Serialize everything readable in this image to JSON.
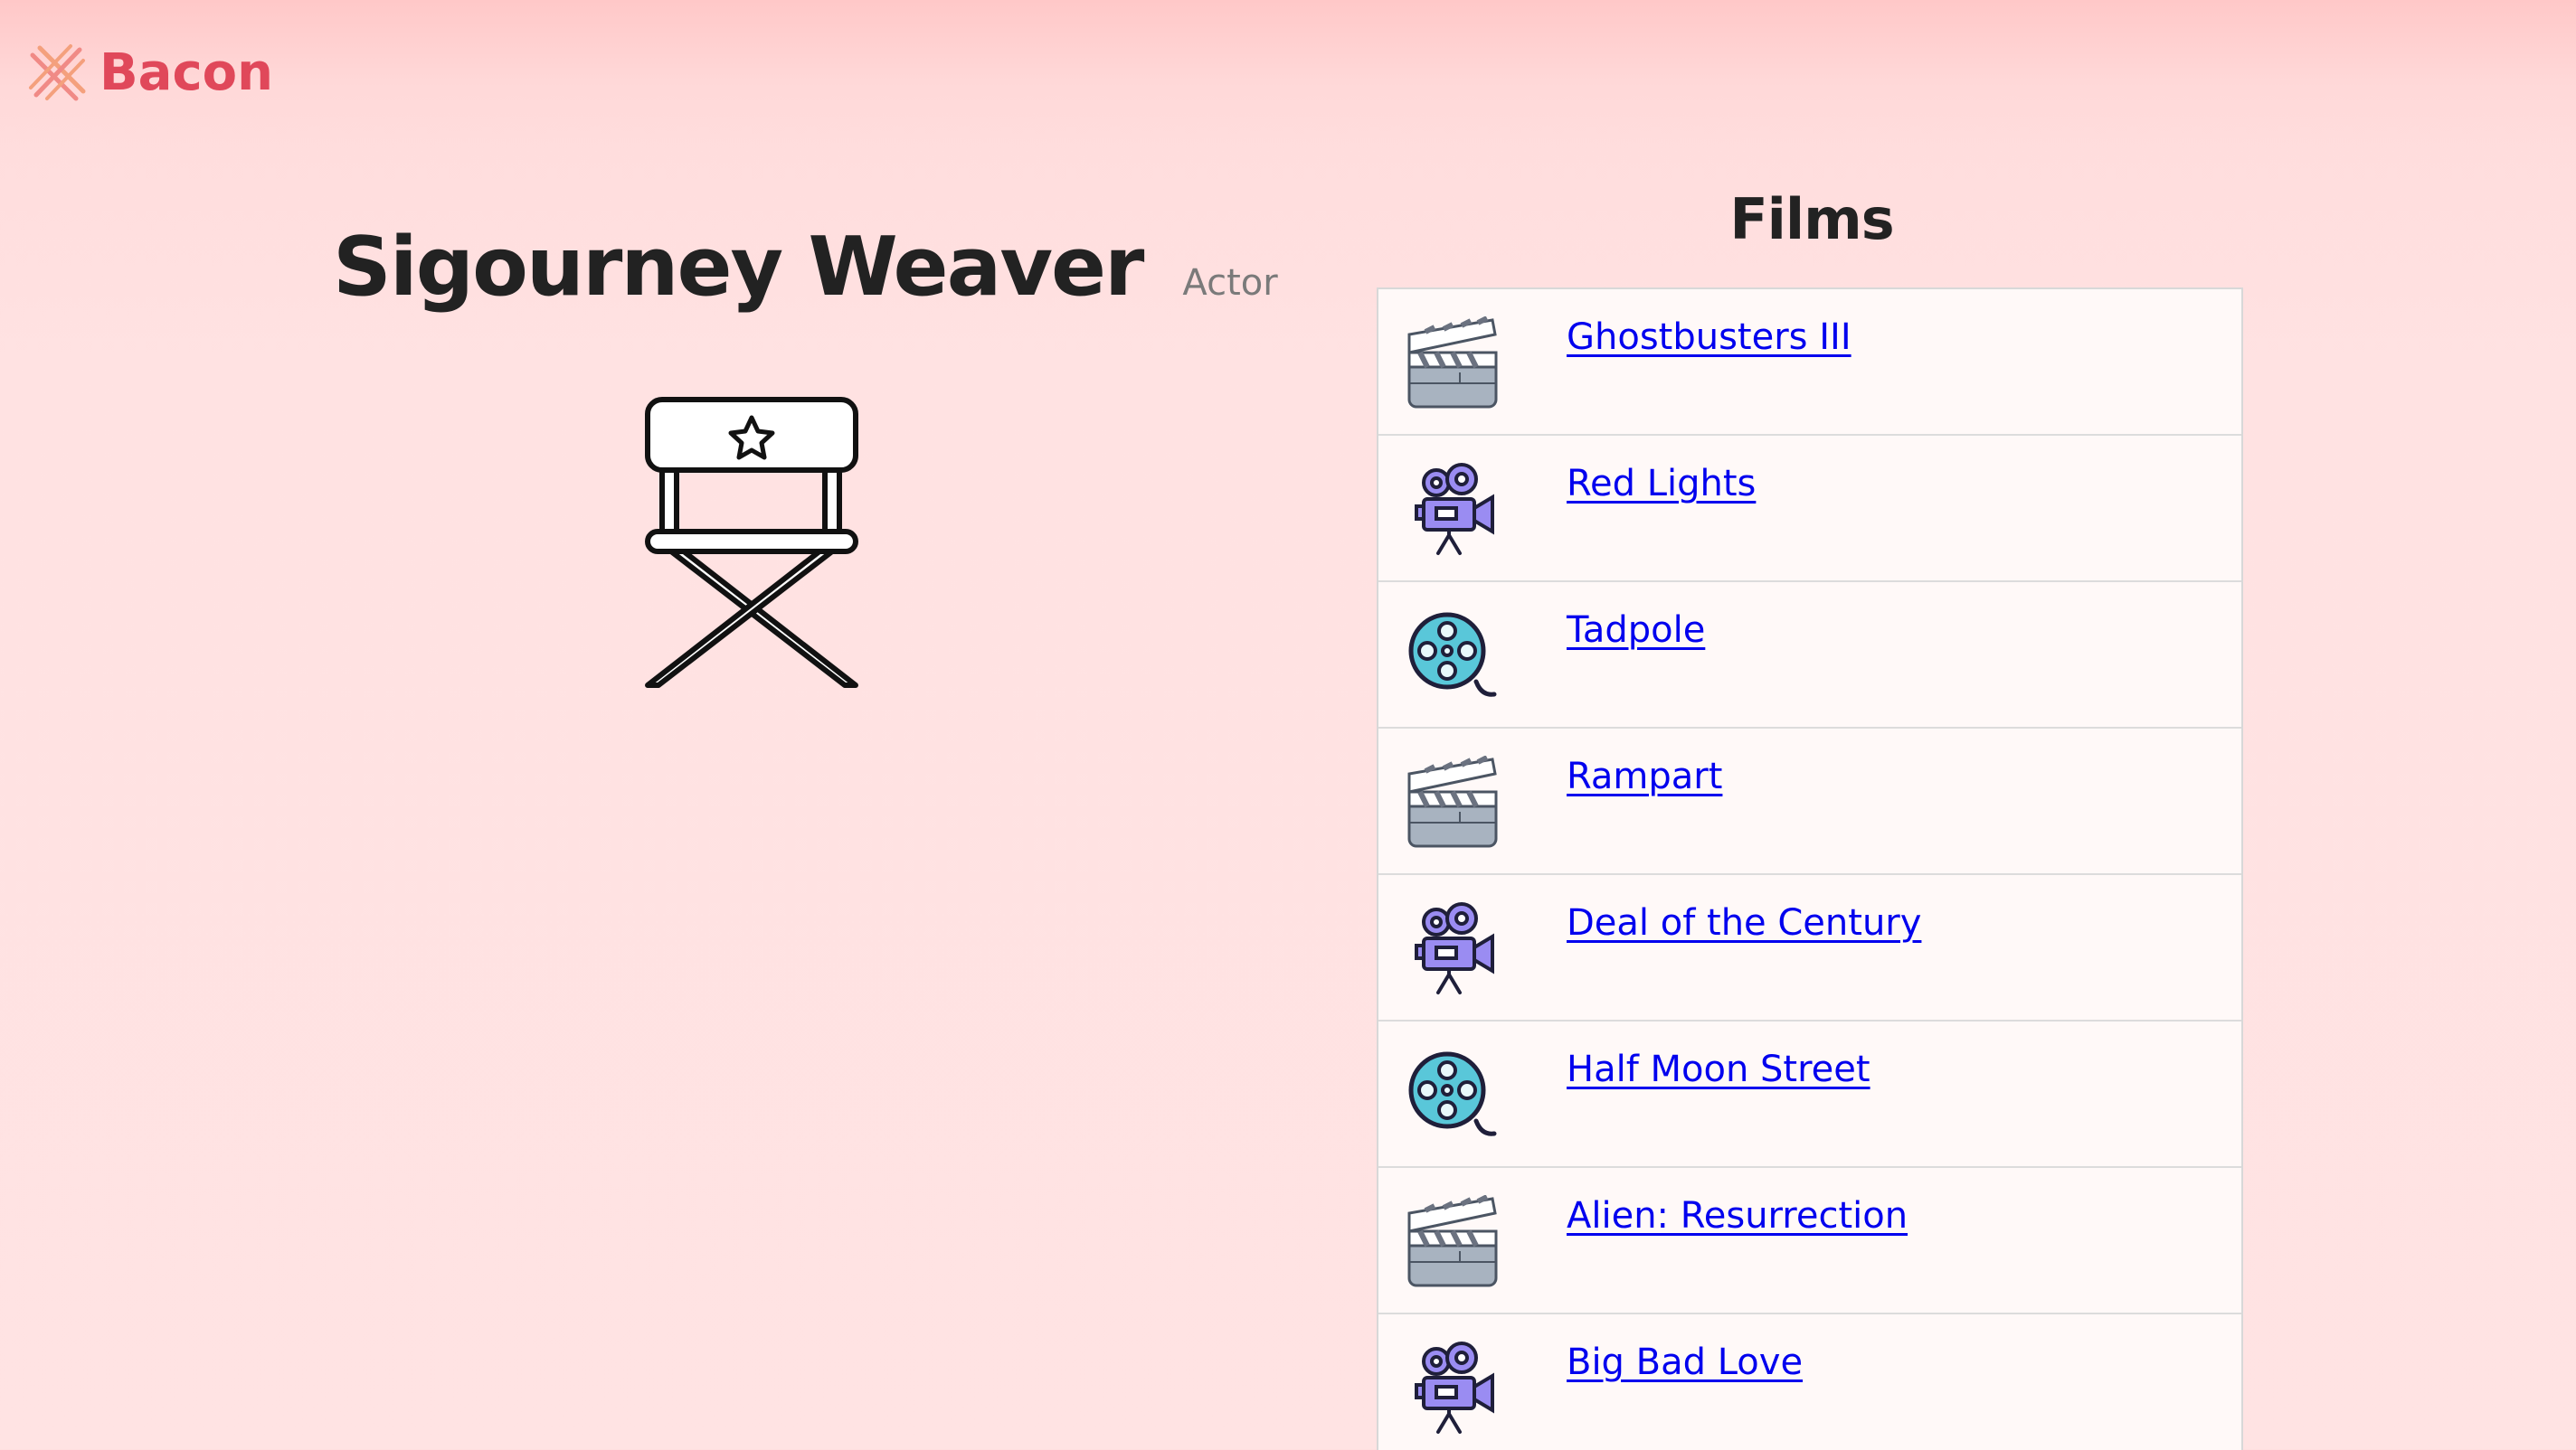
{
  "header": {
    "brand_name": "Bacon",
    "brand_color": "#e0485a",
    "logo_icon": "crossed-strips-logo"
  },
  "person": {
    "name": "Sigourney Weaver",
    "role": "Actor",
    "illustration_icon": "director-chair-icon"
  },
  "films": {
    "title": "Films",
    "link_color": "#0000ee",
    "items": [
      {
        "title": "Ghostbusters III",
        "icon": "clapperboard-icon"
      },
      {
        "title": "Red Lights",
        "icon": "movie-camera-icon"
      },
      {
        "title": "Tadpole",
        "icon": "film-reel-icon"
      },
      {
        "title": "Rampart",
        "icon": "clapperboard-icon"
      },
      {
        "title": "Deal of the Century",
        "icon": "movie-camera-icon"
      },
      {
        "title": "Half Moon Street",
        "icon": "film-reel-icon"
      },
      {
        "title": "Alien: Resurrection",
        "icon": "clapperboard-icon"
      },
      {
        "title": "Big Bad Love",
        "icon": "movie-camera-icon"
      }
    ]
  }
}
